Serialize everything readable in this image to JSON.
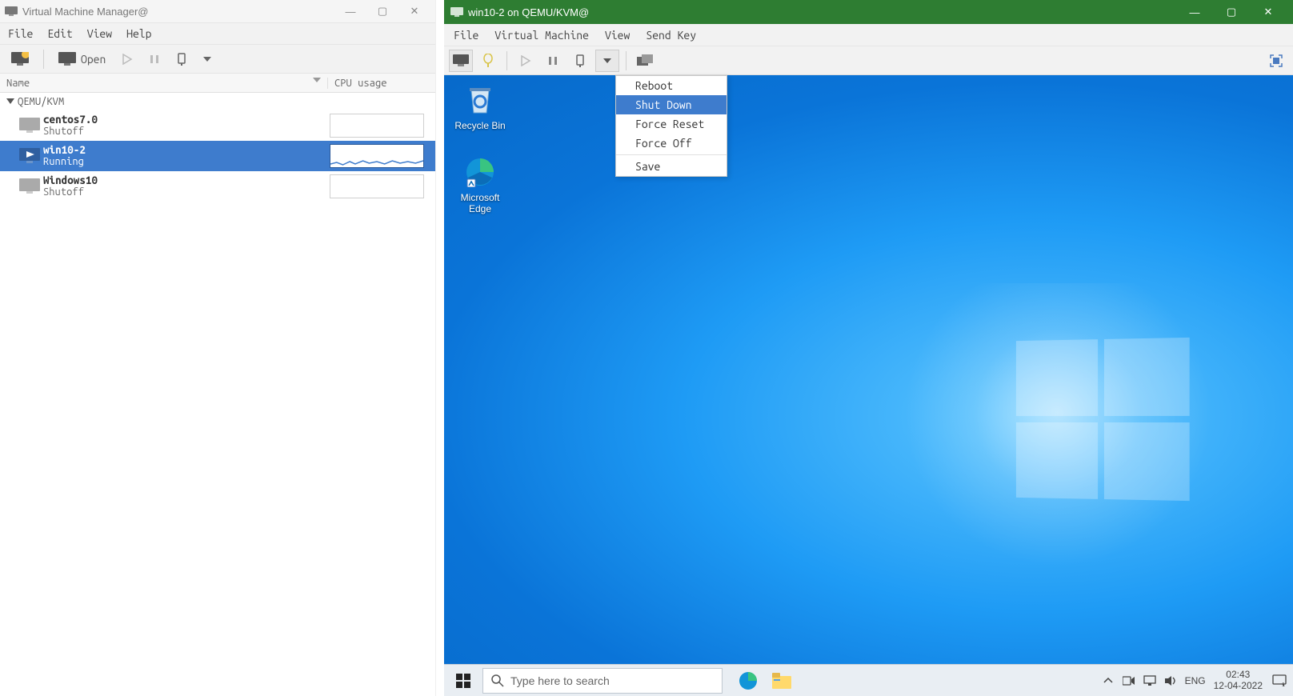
{
  "vmm": {
    "title": "Virtual Machine Manager@",
    "menu": {
      "file": "File",
      "edit": "Edit",
      "view": "View",
      "help": "Help"
    },
    "toolbar": {
      "open_label": "Open"
    },
    "columns": {
      "name": "Name",
      "cpu": "CPU usage"
    },
    "connection": "QEMU/KVM",
    "vms": [
      {
        "name": "centos7.0",
        "state": "Shutoff",
        "running": false
      },
      {
        "name": "win10-2",
        "state": "Running",
        "running": true
      },
      {
        "name": "Windows10",
        "state": "Shutoff",
        "running": false
      }
    ]
  },
  "vmc": {
    "title": "win10-2 on QEMU/KVM@",
    "menu": {
      "file": "File",
      "vm": "Virtual Machine",
      "view": "View",
      "sendkey": "Send Key"
    },
    "power_menu": {
      "items": [
        "Reboot",
        "Shut Down",
        "Force Reset",
        "Force Off",
        "Save"
      ],
      "selected_index": 1
    }
  },
  "guest": {
    "desktop_icons": [
      {
        "label": "Recycle Bin"
      },
      {
        "label": "Microsoft Edge"
      }
    ],
    "taskbar": {
      "search_placeholder": "Type here to search",
      "lang": "ENG",
      "time": "02:43",
      "date": "12-04-2022"
    }
  }
}
